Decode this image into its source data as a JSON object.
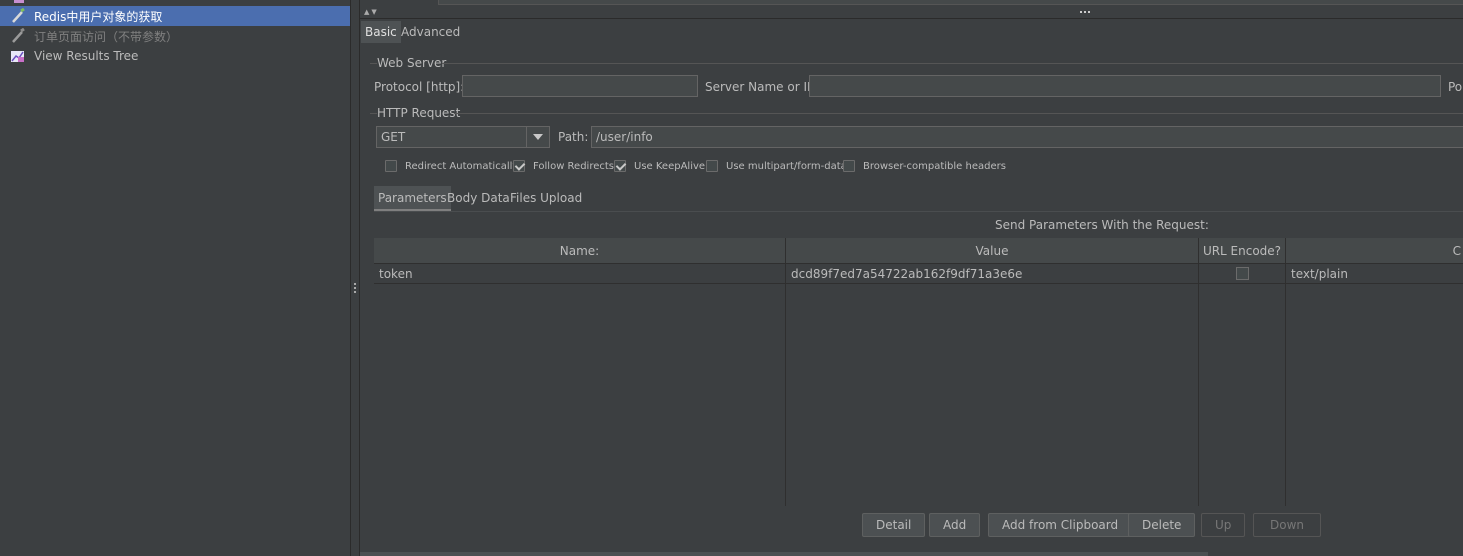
{
  "tree": {
    "items": [
      {
        "label": "Redis中用户对象的获取",
        "state": "selected",
        "icon": "pipette-sampler-icon"
      },
      {
        "label": "订单页面访问（不带参数）",
        "state": "disabled",
        "icon": "pipette-sampler-icon"
      },
      {
        "label": "View Results Tree",
        "state": "normal",
        "icon": "chart-listener-icon"
      }
    ]
  },
  "tabs": {
    "basic": "Basic",
    "advanced": "Advanced"
  },
  "web_server": {
    "section": "Web Server",
    "protocol_label": "Protocol [http]:",
    "protocol_value": "",
    "server_label": "Server Name or IP:",
    "server_value": "",
    "port_label": "Po"
  },
  "http_request": {
    "section": "HTTP Request",
    "method": "GET",
    "path_label": "Path:",
    "path_value": "/user/info"
  },
  "options": [
    {
      "label": "Redirect Automatically",
      "checked": false
    },
    {
      "label": "Follow Redirects",
      "checked": true
    },
    {
      "label": "Use KeepAlive",
      "checked": true
    },
    {
      "label": "Use multipart/form-data",
      "checked": false
    },
    {
      "label": "Browser-compatible headers",
      "checked": false
    }
  ],
  "subtabs": {
    "parameters": "Parameters",
    "body": "Body Data",
    "files": "Files Upload"
  },
  "params": {
    "caption": "Send Parameters With the Request:",
    "headers": {
      "name": "Name:",
      "value": "Value",
      "encode": "URL Encode?",
      "content": "C"
    },
    "rows": [
      {
        "name": "token",
        "value": "dcd89f7ed7a54722ab162f9df71a3e6e",
        "encode": false,
        "content_type": "text/plain"
      }
    ]
  },
  "buttons": {
    "detail": "Detail",
    "add": "Add",
    "clipboard": "Add from Clipboard",
    "delete": "Delete",
    "up": "Up",
    "down": "Down"
  },
  "colors": {
    "selection": "#4b6eaf",
    "background": "#3c3f41"
  }
}
